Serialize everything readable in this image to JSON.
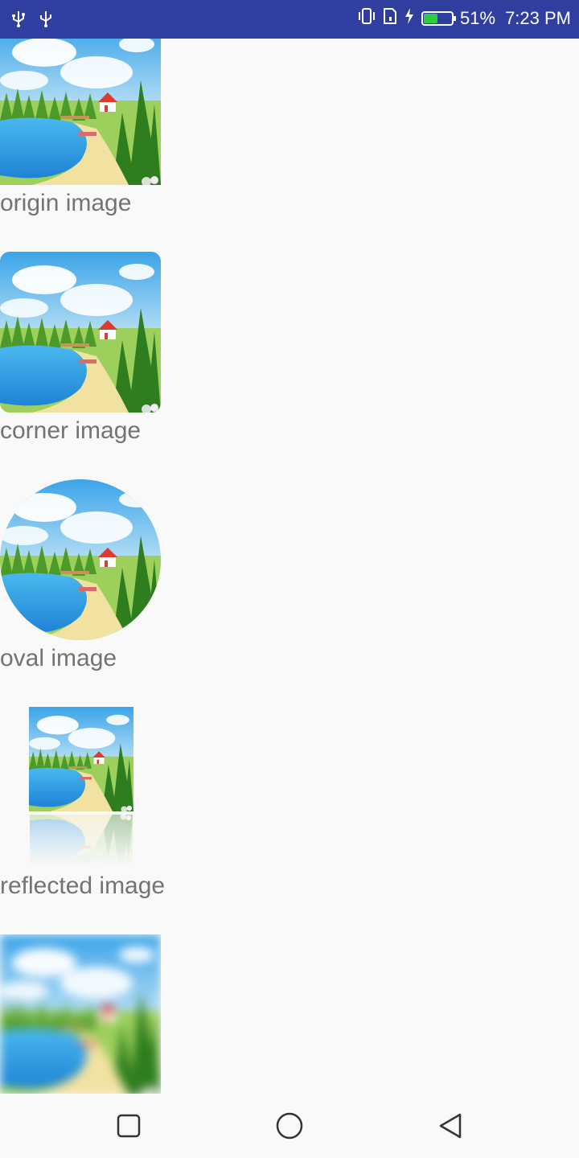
{
  "status_bar": {
    "battery_percent": "51%",
    "time": "7:23 PM",
    "battery_level": 0.51,
    "icons": [
      "usb-icon",
      "usb-icon",
      "vibrate-icon",
      "sim-icon",
      "charging-icon",
      "battery-icon"
    ]
  },
  "items": [
    {
      "caption": "origin image",
      "style": "original"
    },
    {
      "caption": "corner image",
      "style": "rounded-corners"
    },
    {
      "caption": "oval image",
      "style": "oval"
    },
    {
      "caption": "reflected image",
      "style": "reflected"
    },
    {
      "caption": "",
      "style": "blurred"
    }
  ],
  "nav": {
    "buttons": [
      "recents-square-icon",
      "home-circle-icon",
      "back-triangle-icon"
    ]
  },
  "colors": {
    "status_bar": "#303f9f",
    "background": "#f9f9f9",
    "caption_text": "#737373",
    "battery_fill": "#2ecc40"
  }
}
